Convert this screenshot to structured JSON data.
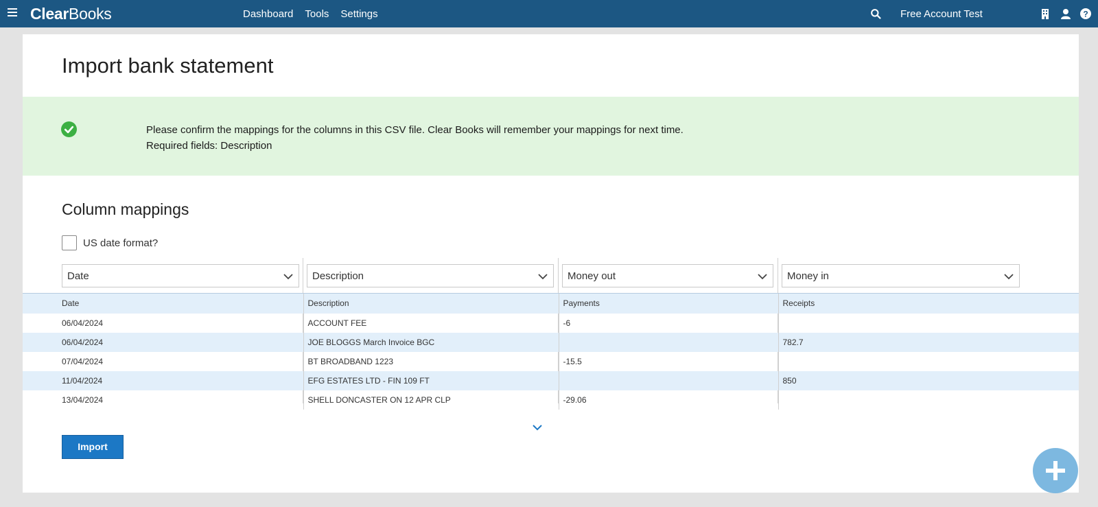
{
  "app": {
    "logo_part1": "Clear",
    "logo_part2": "Books",
    "nav": [
      "Dashboard",
      "Tools",
      "Settings"
    ],
    "account_name": "Free Account Test",
    "icons": [
      "menu-icon",
      "search-icon",
      "building-icon",
      "user-icon",
      "help-icon"
    ]
  },
  "page": {
    "title": "Import bank statement"
  },
  "alert": {
    "line1": "Please confirm the mappings for the columns in this CSV file. Clear Books will remember your mappings for next time.",
    "line2": "Required fields: Description",
    "background": "#e1f5df",
    "icon_color": "#3cb043"
  },
  "mappings": {
    "title": "Column mappings",
    "us_date_label": "US date format?",
    "us_date_checked": false,
    "selects": [
      "Date",
      "Description",
      "Money out",
      "Money in"
    ]
  },
  "table": {
    "headers": [
      "Date",
      "Description",
      "Payments",
      "Receipts"
    ],
    "rows": [
      [
        "06/04/2024",
        "ACCOUNT FEE",
        "-6",
        ""
      ],
      [
        "06/04/2024",
        "JOE BLOGGS March Invoice BGC",
        "",
        "782.7"
      ],
      [
        "07/04/2024",
        "BT BROADBAND 1223",
        "-15.5",
        ""
      ],
      [
        "11/04/2024",
        "EFG ESTATES LTD - FIN 109 FT",
        "",
        "850"
      ],
      [
        "13/04/2024",
        "SHELL DONCASTER ON 12 APR CLP",
        "-29.06",
        ""
      ]
    ]
  },
  "actions": {
    "import_label": "Import"
  },
  "colors": {
    "brand": "#1c5783",
    "primary_button": "#1c78c5",
    "row_alt": "#e2effa",
    "fab": "#7db8e0"
  }
}
